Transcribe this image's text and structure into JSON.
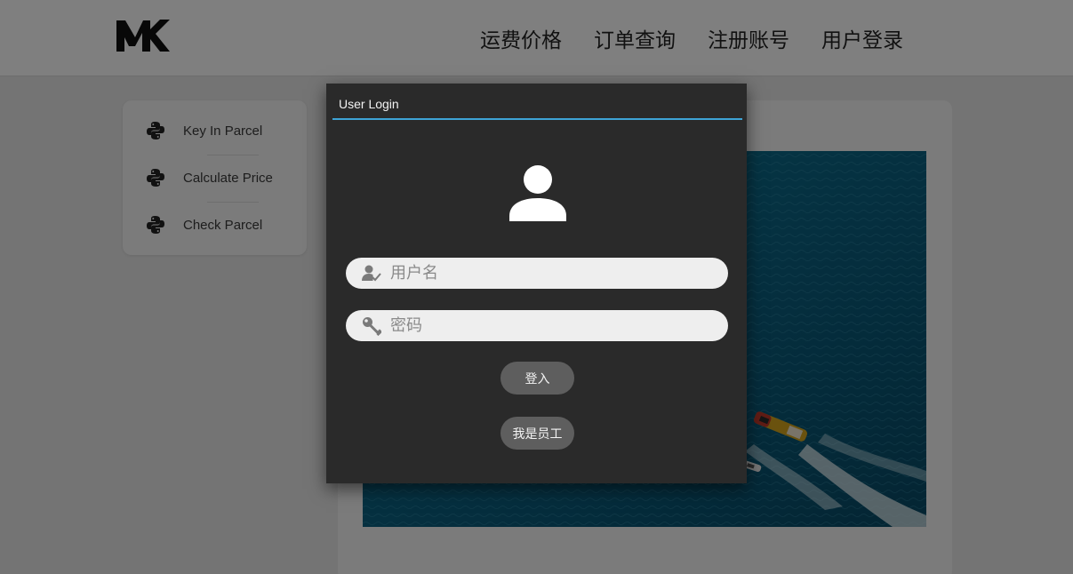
{
  "brand": {
    "logo_text": "MK"
  },
  "nav": {
    "items": [
      {
        "label": "运费价格"
      },
      {
        "label": "订单查询"
      },
      {
        "label": "注册账号"
      },
      {
        "label": "用户登录"
      }
    ]
  },
  "sidebar": {
    "items": [
      {
        "label": "Key In Parcel",
        "icon": "python-icon"
      },
      {
        "label": "Calculate Price",
        "icon": "python-icon"
      },
      {
        "label": "Check Parcel",
        "icon": "python-icon"
      }
    ]
  },
  "main": {
    "image": "aerial-ship-ocean-image"
  },
  "dialog": {
    "title": "User Login",
    "accent_color": "#3ea3d6",
    "avatar_icon": "user-icon",
    "username": {
      "placeholder": "用户名",
      "value": "",
      "icon": "user-check-icon"
    },
    "password": {
      "placeholder": "密码",
      "value": "",
      "icon": "key-icon"
    },
    "login_button": "登入",
    "staff_button": "我是员工"
  }
}
